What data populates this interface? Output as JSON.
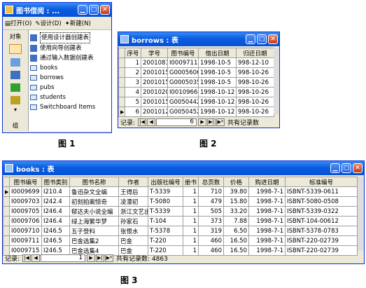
{
  "win1": {
    "title": "图书借阅 : ...",
    "toolbar": {
      "open": "打开(O)",
      "design": "设计(D)",
      "new": "新建(N)"
    },
    "left_tabs": {
      "objects": "对象",
      "groups": "组"
    },
    "items": [
      "使用设计器创建表",
      "使用向导创建表",
      "通过输入数据创建表",
      "books",
      "borrows",
      "pubs",
      "students",
      "Switchboard Items"
    ]
  },
  "win2": {
    "title": "borrows : 表",
    "columns": [
      "序号",
      "学号",
      "图书编号",
      "借出日期",
      "归还日期"
    ],
    "rows": [
      [
        "1",
        "20010810",
        "I0009711",
        "1998-10-5",
        "998-12-10"
      ],
      [
        "2",
        "20010155",
        "G0005606",
        "1998-10-5",
        "998-10-26"
      ],
      [
        "3",
        "20010154",
        "G0005035",
        "1998-10-5",
        "998-10-26"
      ],
      [
        "4",
        "20010205",
        "I0010966",
        "1998-10-12",
        "998-10-26"
      ],
      [
        "5",
        "20010150",
        "G0050442",
        "1998-10-12",
        "998-10-26"
      ],
      [
        "6",
        "20010128",
        "G0050452",
        "1998-10-12",
        "998-10-26"
      ]
    ],
    "nav": {
      "record_label": "记录:",
      "current": "6",
      "total_label": "共有记录数"
    }
  },
  "win3": {
    "title": "books : 表",
    "columns": [
      "图书编号",
      "图书类别",
      "图书名称",
      "作者",
      "出版社编号",
      "册书",
      "总页数",
      "价格",
      "购进日期",
      "标准编号"
    ],
    "rows": [
      [
        "I0009699",
        "I210.4",
        "鲁迅杂文全编",
        "王得后",
        "T-5339",
        "1",
        "710",
        "39.80",
        "1998-7-1",
        "ISBNT-5339-0611"
      ],
      [
        "I0009703",
        "I242.4",
        "初刻拍案惊奇",
        "凌濛初",
        "T-5080",
        "1",
        "479",
        "15.80",
        "1998-7-1",
        "ISBNT-5080-0508"
      ],
      [
        "I0009705",
        "I246.4",
        "郁达夫小说全编",
        "浙江文艺出",
        "T-5339",
        "1",
        "505",
        "33.20",
        "1998-7-1",
        "ISBNT-5339-0322"
      ],
      [
        "I0009706",
        "I246.4",
        "绿上海繁华梦",
        "孙家石",
        "T-104",
        "1",
        "373",
        "7.88",
        "1998-7-1",
        "ISBNT-104-00612"
      ],
      [
        "I0009710",
        "I246.5",
        "五子登科",
        "张恨水",
        "T-5378",
        "1",
        "319",
        "6.50",
        "1998-7-1",
        "ISBNT-5378-0783"
      ],
      [
        "I0009711",
        "I246.5",
        "巴金选集2",
        "巴金",
        "T-220",
        "1",
        "460",
        "16.50",
        "1998-7-1",
        "ISBNT-220-02739"
      ],
      [
        "I0009715",
        "I246.5",
        "巴金选集4",
        "巴金",
        "T-220",
        "1",
        "460",
        "16.50",
        "1998-7-1",
        "ISBNT-220-02739"
      ]
    ],
    "nav": {
      "record_label": "记录:",
      "current": "1",
      "total_label": "共有记录数: 4863"
    }
  },
  "captions": {
    "fig1": "图 1",
    "fig2": "图 2",
    "fig3": "图 3"
  }
}
